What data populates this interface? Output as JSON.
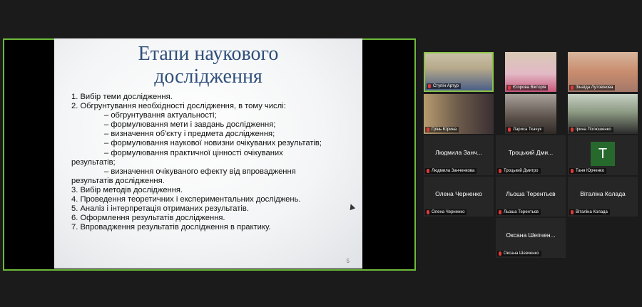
{
  "slide": {
    "title_line1": "Етапи наукового",
    "title_line2": "дослідження",
    "lines": [
      "1. Вибір теми дослідження.",
      "2. Обгрунтування необхідності дослідження, в тому числі:",
      "– обгрунтування актуальності;",
      "– формулювання мети і завдань дослідження;",
      "– визначення об'єкту і предмета дослідження;",
      "– формулювання наукової новизни очікуваних результатів;",
      "– формулювання практичної цінності очікуваних",
      "результатів;",
      "– визначення очікуваного ефекту від впровадження",
      "результатів дослідження.",
      "3. Вибір методів дослідження.",
      "4. Проведення теоретичних і експериментальних досліджень.",
      "5. Аналіз і інтерпретація отриманих результатів.",
      "6. Оформлення результатів дослідження.",
      "7. Впровадження результатів дослідження в практику."
    ],
    "page_number": "5"
  },
  "participants": [
    {
      "tag": "Ступін Артур",
      "video": true
    },
    {
      "tag": "Єгорова Вікторія",
      "video": true
    },
    {
      "tag": "Зінаїда Лутовінова",
      "video": true
    },
    {
      "tag": "Грінь Юрина",
      "video": true
    },
    {
      "tag": "Лариса Ткачук",
      "video": true
    },
    {
      "tag": "Ірина Полюшенко",
      "video": true
    },
    {
      "display": "Людмила Занч...",
      "tag": "Людмила Занченкова"
    },
    {
      "display": "Троцький Дми...",
      "tag": "Троцький Дмитро"
    },
    {
      "avatar": "T",
      "tag": "Таня Юрченко"
    },
    {
      "display": "Олена Черненко",
      "tag": "Олена Черненко"
    },
    {
      "display": "Льоша Терентьєв",
      "tag": "Льоша Терентьєв"
    },
    {
      "display": "Віталіна Колада",
      "tag": "Віталіна Колада"
    },
    {
      "display": "Оксана Шепчен...",
      "tag": "Оксана Шевченко"
    }
  ],
  "colors": {
    "accent": "#8bc34a",
    "slide_title": "#2f4f7a",
    "avatar": "#27692d",
    "mic_muted": "#e03a3a"
  }
}
